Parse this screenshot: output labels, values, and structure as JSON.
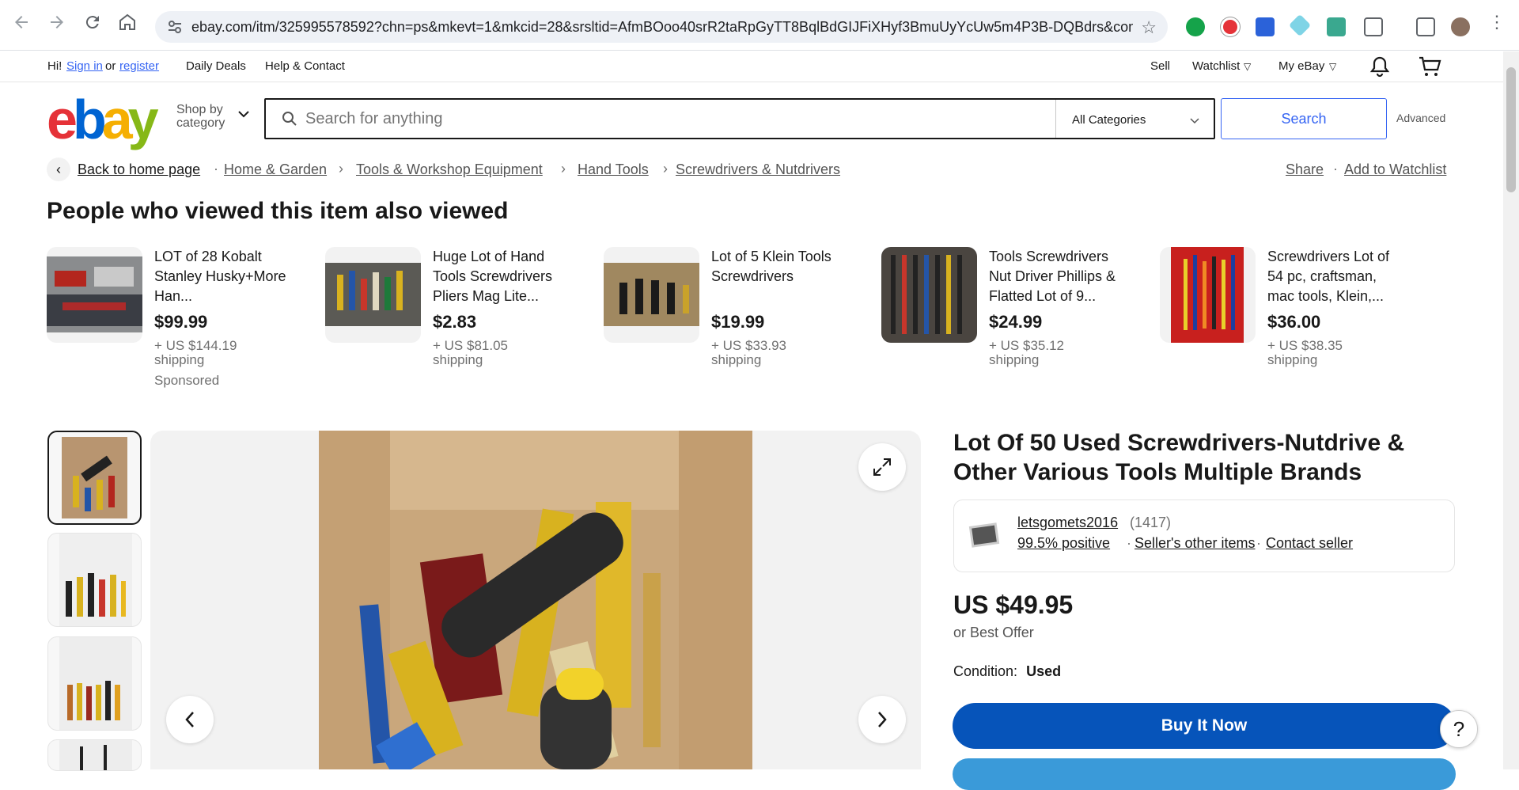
{
  "browser": {
    "url": "ebay.com/itm/325995578592?chn=ps&mkevt=1&mkcid=28&srsltid=AfmBOoo40srR2taRpGyTT8BqlBdGIJFiXHyf3BmuUyYcUw5m4P3B-DQBdrs&com_cv..."
  },
  "topbar": {
    "greeting": "Hi!",
    "signin": "Sign in",
    "or": "or",
    "register": "register",
    "daily_deals": "Daily Deals",
    "help_contact": "Help & Contact",
    "sell": "Sell",
    "watchlist": "Watchlist",
    "my_ebay": "My eBay"
  },
  "header": {
    "logo_letters": [
      "e",
      "b",
      "a",
      "y"
    ],
    "logo_colors": [
      "#e53238",
      "#0064d2",
      "#f5af02",
      "#86b817"
    ],
    "shop_by": "Shop by",
    "category": "category",
    "search_placeholder": "Search for anything",
    "category_select": "All Categories",
    "search_button": "Search",
    "advanced": "Advanced"
  },
  "breadcrumb": {
    "back": "Back to home page",
    "items": [
      "Home & Garden",
      "Tools & Workshop Equipment",
      "Hand Tools",
      "Screwdrivers & Nutdrivers"
    ],
    "share": "Share",
    "add_watchlist": "Add to Watchlist"
  },
  "also_viewed": {
    "heading": "People who viewed this item also viewed",
    "sponsored": "Sponsored",
    "items": [
      {
        "title": "LOT of 28 Kobalt Stanley Husky+More Han...",
        "price": "$99.99",
        "shipping": "+ US $144.19 shipping"
      },
      {
        "title": "Huge Lot of Hand Tools Screwdrivers Pliers Mag Lite...",
        "price": "$2.83",
        "shipping": "+ US $81.05 shipping"
      },
      {
        "title": "Lot of 5 Klein Tools Screwdrivers",
        "price": "$19.99",
        "shipping": "+ US $33.93 shipping"
      },
      {
        "title": "Tools Screwdrivers Nut Driver Phillips & Flatted Lot of 9...",
        "price": "$24.99",
        "shipping": "+ US $35.12 shipping"
      },
      {
        "title": "Screwdrivers Lot of 54 pc, craftsman, mac tools, Klein,...",
        "price": "$36.00",
        "shipping": "+ US $38.35 shipping"
      }
    ]
  },
  "product": {
    "title": "Lot Of 50 Used Screwdrivers-Nutdrive & Other Various Tools Multiple Brands",
    "seller_name": "letsgomets2016",
    "seller_count": "(1417)",
    "positive": "99.5% positive",
    "other_items": "Seller's other items",
    "contact": "Contact seller",
    "price": "US $49.95",
    "best_offer": "or Best Offer",
    "condition_label": "Condition:",
    "condition_value": "Used",
    "buy_now": "Buy It Now",
    "help": "?"
  }
}
